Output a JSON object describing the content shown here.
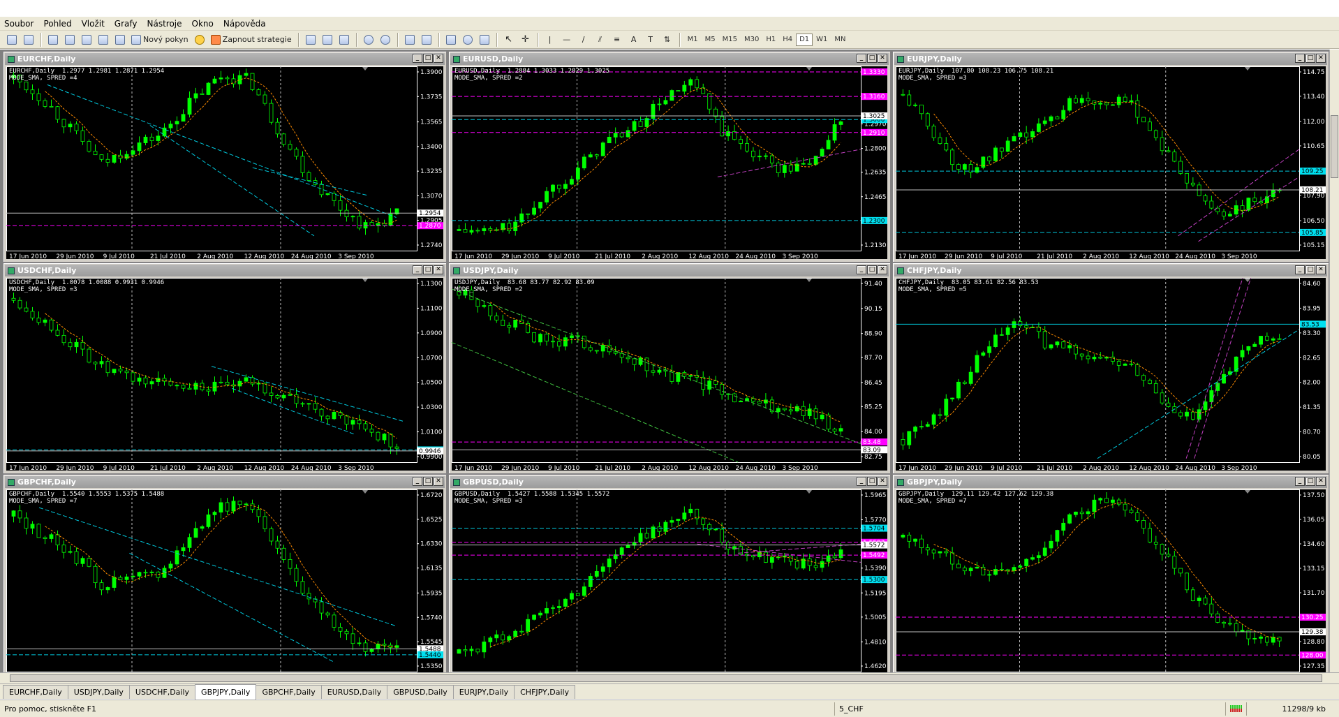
{
  "menu": [
    "Soubor",
    "Pohled",
    "Vložit",
    "Grafy",
    "Nástroje",
    "Okno",
    "Nápověda"
  ],
  "toolbar": {
    "new_order": "Nový pokyn",
    "strategies": "Zapnout strategie",
    "timeframes": [
      "M1",
      "M5",
      "M15",
      "M30",
      "H1",
      "H4",
      "D1",
      "W1",
      "MN"
    ],
    "active_timeframe": "D1"
  },
  "charts": [
    {
      "title": "EURCHF,Daily",
      "info1": "EURCHF,Daily  1.2977 1.2981 1.2871 1.2954",
      "info2": "MODE_SMA, SPRED =4",
      "prices": [
        "1.3900",
        "1.3735",
        "1.3565",
        "1.3400",
        "1.3235",
        "1.3070",
        "1.2905",
        "1.2740"
      ],
      "dates": [
        "17 Jun 2010",
        "29 Jun 2010",
        "9 Jul 2010",
        "21 Jul 2010",
        "2 Aug 2010",
        "12 Aug 2010",
        "24 Aug 2010",
        "3 Sep 2010"
      ],
      "trend": [
        1.386,
        1.372,
        1.35,
        1.328,
        1.34,
        1.348,
        1.37,
        1.387,
        1.385,
        1.35,
        1.32,
        1.3,
        1.285,
        1.295
      ],
      "hlines": [
        {
          "v": 1.2954,
          "c": "#c0c0c0",
          "dash": false,
          "tag": "1.2954",
          "tagc": "#fff",
          "tagt": "#000"
        },
        {
          "v": 1.287,
          "c": "#ff00ff",
          "dash": true,
          "tag": "1.2870",
          "tagc": "#ff00ff",
          "tagt": "#fff"
        }
      ],
      "tlines": [
        [
          0.1,
          0.1,
          0.95,
          0.82,
          "#00c8dc"
        ],
        [
          0.35,
          0.32,
          0.75,
          0.92,
          "#00c8dc"
        ],
        [
          0.6,
          0.55,
          0.88,
          0.7,
          "#00c8dc"
        ]
      ]
    },
    {
      "title": "EURUSD,Daily",
      "info1": "EURUSD,Daily  1.2884 1.3033 1.2829 1.3025",
      "info2": "MODE_SMA, SPRED =2",
      "prices": [
        "1.3330",
        "1.3160",
        "1.2970",
        "1.2800",
        "1.2635",
        "1.2465",
        "1.2300",
        "1.2130"
      ],
      "dates": [
        "17 Jun 2010",
        "29 Jun 2010",
        "9 Jul 2010",
        "21 Jul 2010",
        "2 Aug 2010",
        "12 Aug 2010",
        "24 Aug 2010",
        "3 Sep 2010"
      ],
      "trend": [
        1.223,
        1.222,
        1.228,
        1.25,
        1.265,
        1.285,
        1.295,
        1.315,
        1.325,
        1.29,
        1.278,
        1.265,
        1.27,
        1.3
      ],
      "hlines": [
        {
          "v": 1.333,
          "c": "#ff00ff",
          "dash": true,
          "tag": "1.3330",
          "tagc": "#ff00ff",
          "tagt": "#fff"
        },
        {
          "v": 1.316,
          "c": "#ff00ff",
          "dash": true,
          "tag": "1.3160",
          "tagc": "#ff00ff",
          "tagt": "#fff"
        },
        {
          "v": 1.3,
          "c": "#00c8dc",
          "dash": true,
          "tag": "1.3000",
          "tagc": "#00e0f0",
          "tagt": "#000"
        },
        {
          "v": 1.3025,
          "c": "#c0c0c0",
          "dash": false,
          "tag": "1.3025",
          "tagc": "#fff",
          "tagt": "#000"
        },
        {
          "v": 1.291,
          "c": "#ff00ff",
          "dash": true,
          "tag": "1.2910",
          "tagc": "#ff00ff",
          "tagt": "#fff"
        },
        {
          "v": 1.23,
          "c": "#00c8dc",
          "dash": true,
          "tag": "1.2300",
          "tagc": "#00e0f0",
          "tagt": "#000"
        }
      ],
      "tlines": [
        [
          0.65,
          0.6,
          1.0,
          0.45,
          "#c040c0"
        ]
      ]
    },
    {
      "title": "EURJPY,Daily",
      "info1": "EURJPY,Daily  107.80 108.23 106.75 108.21",
      "info2": "MODE_SMA, SPRED =3",
      "prices": [
        "114.75",
        "113.40",
        "112.00",
        "110.65",
        "109.25",
        "107.90",
        "106.50",
        "105.15"
      ],
      "dates": [
        "17 Jun 2010",
        "29 Jun 2010",
        "9 Jul 2010",
        "21 Jul 2010",
        "2 Aug 2010",
        "12 Aug 2010",
        "24 Aug 2010",
        "3 Sep 2010"
      ],
      "trend": [
        113.5,
        111.5,
        109.2,
        110,
        111,
        112,
        113.4,
        113.2,
        112.8,
        110.5,
        108.2,
        106.8,
        107.5,
        108
      ],
      "hlines": [
        {
          "v": 109.25,
          "c": "#00c8dc",
          "dash": true,
          "tag": "109.25",
          "tagc": "#00e0f0",
          "tagt": "#000"
        },
        {
          "v": 108.21,
          "c": "#c0c0c0",
          "dash": false,
          "tag": "108.21",
          "tagc": "#fff",
          "tagt": "#000"
        },
        {
          "v": 105.85,
          "c": "#00c8dc",
          "dash": true,
          "tag": "105.85",
          "tagc": "#00e0f0",
          "tagt": "#000"
        }
      ],
      "tlines": [
        [
          0.7,
          0.92,
          1.0,
          0.45,
          "#c040c0"
        ],
        [
          0.75,
          0.95,
          1.0,
          0.6,
          "#c040c0"
        ]
      ]
    },
    {
      "title": "USDCHF,Daily",
      "info1": "USDCHF,Daily  1.0078 1.0088 0.9931 0.9946",
      "info2": "MODE_SMA, SPRED =3",
      "prices": [
        "1.1300",
        "1.1100",
        "1.0900",
        "1.0700",
        "1.0500",
        "1.0300",
        "1.0100",
        "0.9900"
      ],
      "dates": [
        "17 Jun 2010",
        "29 Jun 2010",
        "9 Jul 2010",
        "21 Jul 2010",
        "2 Aug 2010",
        "12 Aug 2010",
        "24 Aug 2010",
        "3 Sep 2010"
      ],
      "trend": [
        1.118,
        1.1,
        1.08,
        1.062,
        1.052,
        1.05,
        1.048,
        1.045,
        1.05,
        1.04,
        1.03,
        1.02,
        1.012,
        1.0
      ],
      "hlines": [
        {
          "v": 0.9954,
          "c": "#00c8dc",
          "dash": true,
          "tag": "0.9954",
          "tagc": "#00e0f0",
          "tagt": "#000"
        },
        {
          "v": 0.9946,
          "c": "#c0c0c0",
          "dash": false,
          "tag": "0.9946",
          "tagc": "#fff",
          "tagt": "#000"
        }
      ],
      "tlines": [
        [
          0.5,
          0.48,
          0.97,
          0.78,
          "#00c8dc"
        ],
        [
          0.55,
          0.6,
          0.85,
          0.85,
          "#00c8dc"
        ]
      ]
    },
    {
      "title": "USDJPY,Daily",
      "info1": "USDJPY,Daily  83.68 83.77 82.92 83.09",
      "info2": "MODE_SMA, SPRED =2",
      "prices": [
        "91.40",
        "90.15",
        "88.90",
        "87.70",
        "86.45",
        "85.25",
        "84.00",
        "82.75"
      ],
      "dates": [
        "17 Jun 2010",
        "29 Jun 2010",
        "9 Jul 2010",
        "21 Jul 2010",
        "2 Aug 2010",
        "12 Aug 2010",
        "24 Aug 2010",
        "3 Sep 2010"
      ],
      "trend": [
        91,
        90,
        89.2,
        88.4,
        88.6,
        88,
        87.5,
        86.8,
        86.5,
        86,
        85.4,
        85.2,
        84.8,
        84.1
      ],
      "hlines": [
        {
          "v": 83.48,
          "c": "#ff00ff",
          "dash": true,
          "tag": "83.48",
          "tagc": "#ff00ff",
          "tagt": "#fff"
        },
        {
          "v": 83.09,
          "c": "#c0c0c0",
          "dash": false,
          "tag": "83.09",
          "tagc": "#fff",
          "tagt": "#000"
        }
      ],
      "tlines": [
        [
          0.0,
          0.06,
          1.0,
          0.9,
          "#40c040"
        ],
        [
          0.0,
          0.35,
          0.7,
          1.0,
          "#40c040"
        ]
      ]
    },
    {
      "title": "CHFJPY,Daily",
      "info1": "CHFJPY,Daily  83.05 83.61 82.56 83.53",
      "info2": "MODE_SMA, SPRED =5",
      "prices": [
        "84.60",
        "83.95",
        "83.30",
        "82.65",
        "82.00",
        "81.35",
        "80.70",
        "80.05"
      ],
      "dates": [
        "17 Jun 2010",
        "29 Jun 2010",
        "9 Jul 2010",
        "21 Jul 2010",
        "2 Aug 2010",
        "12 Aug 2010",
        "24 Aug 2010",
        "3 Sep 2010"
      ],
      "trend": [
        80.5,
        81,
        82,
        83,
        83.6,
        83,
        82.8,
        82.6,
        82.3,
        81.5,
        81,
        82,
        83,
        83.3
      ],
      "hlines": [
        {
          "v": 83.53,
          "c": "#00c8dc",
          "dash": false,
          "tag": "83.53",
          "tagc": "#00e0f0",
          "tagt": "#000"
        }
      ],
      "tlines": [
        [
          0.5,
          0.98,
          1.0,
          0.28,
          "#00c8dc"
        ],
        [
          0.72,
          0.98,
          0.86,
          0.0,
          "#c040c0"
        ],
        [
          0.74,
          0.98,
          0.88,
          0.0,
          "#c040c0"
        ]
      ]
    },
    {
      "title": "GBPCHF,Daily",
      "info1": "GBPCHF,Daily  1.5540 1.5553 1.5375 1.5488",
      "info2": "MODE_SMA, SPRED =7",
      "prices": [
        "1.6720",
        "1.6525",
        "1.6330",
        "1.6135",
        "1.5935",
        "1.5740",
        "1.5545",
        "1.5350"
      ],
      "dates": [
        "17 Jun 2010",
        "29 Jun 2010",
        "9 Jul 2010",
        "21 Jul 2010",
        "2 Aug 2010",
        "12 Aug 2010",
        "24 Aug 2010",
        "3 Sep 2010"
      ],
      "trend": [
        1.655,
        1.64,
        1.625,
        1.6,
        1.605,
        1.61,
        1.64,
        1.665,
        1.66,
        1.63,
        1.59,
        1.565,
        1.55,
        1.552
      ],
      "hlines": [
        {
          "v": 1.5488,
          "c": "#c0c0c0",
          "dash": false,
          "tag": "1.5488",
          "tagc": "#fff",
          "tagt": "#000"
        },
        {
          "v": 1.544,
          "c": "#00c8dc",
          "dash": true,
          "tag": "1.5440",
          "tagc": "#00e0f0",
          "tagt": "#000"
        }
      ],
      "tlines": [
        [
          0.08,
          0.1,
          0.95,
          0.75,
          "#00c8dc"
        ],
        [
          0.3,
          0.35,
          0.8,
          0.95,
          "#00c8dc"
        ]
      ]
    },
    {
      "title": "GBPUSD,Daily",
      "info1": "GBPUSD,Daily  1.5427 1.5588 1.5345 1.5572",
      "info2": "MODE_SMA, SPRED =3",
      "prices": [
        "1.5965",
        "1.5770",
        "1.5580",
        "1.5390",
        "1.5195",
        "1.5005",
        "1.4810",
        "1.4620"
      ],
      "dates": [],
      "trend": [
        1.472,
        1.48,
        1.492,
        1.505,
        1.52,
        1.545,
        1.56,
        1.575,
        1.582,
        1.56,
        1.55,
        1.545,
        1.54,
        1.55
      ],
      "hlines": [
        {
          "v": 1.5704,
          "c": "#00c8dc",
          "dash": true,
          "tag": "1.5704",
          "tagc": "#00e0f0",
          "tagt": "#000"
        },
        {
          "v": 1.5593,
          "c": "#ff00ff",
          "dash": true,
          "tag": "1.5593",
          "tagc": "#ff00ff",
          "tagt": "#fff"
        },
        {
          "v": 1.5572,
          "c": "#c0c0c0",
          "dash": false,
          "tag": "1.5572",
          "tagc": "#fff",
          "tagt": "#000"
        },
        {
          "v": 1.5492,
          "c": "#ff00ff",
          "dash": true,
          "tag": "1.5492",
          "tagc": "#ff00ff",
          "tagt": "#fff"
        },
        {
          "v": 1.53,
          "c": "#00c8dc",
          "dash": true,
          "tag": "1.5300",
          "tagc": "#00e0f0",
          "tagt": "#000"
        }
      ],
      "tlines": [
        [
          0.6,
          0.3,
          1.0,
          0.4,
          "#c040c0"
        ],
        [
          0.7,
          0.35,
          1.0,
          0.3,
          "#c040c0"
        ]
      ]
    },
    {
      "title": "GBPJPY,Daily",
      "info1": "GBPJPY,Daily  129.11 129.42 127.62 129.38",
      "info2": "MODE_SMA, SPRED =7",
      "prices": [
        "137.50",
        "136.05",
        "134.60",
        "133.15",
        "131.70",
        "130.25",
        "128.80",
        "127.35"
      ],
      "dates": [],
      "trend": [
        135,
        134.2,
        133.4,
        132.8,
        133.2,
        134.6,
        136.5,
        137.2,
        136,
        134,
        131.5,
        130,
        129.2,
        129
      ],
      "hlines": [
        {
          "v": 130.25,
          "c": "#ff00ff",
          "dash": true,
          "tag": "130.25",
          "tagc": "#ff00ff",
          "tagt": "#fff"
        },
        {
          "v": 129.38,
          "c": "#c0c0c0",
          "dash": false,
          "tag": "129.38",
          "tagc": "#fff",
          "tagt": "#000"
        },
        {
          "v": 128.0,
          "c": "#ff00ff",
          "dash": true,
          "tag": "128.00",
          "tagc": "#ff00ff",
          "tagt": "#fff"
        }
      ],
      "tlines": []
    }
  ],
  "tabs": [
    "EURCHF,Daily",
    "USDJPY,Daily",
    "USDCHF,Daily",
    "GBPJPY,Daily",
    "GBPCHF,Daily",
    "EURUSD,Daily",
    "GBPUSD,Daily",
    "EURJPY,Daily",
    "CHFJPY,Daily"
  ],
  "active_tab": "GBPJPY,Daily",
  "status": {
    "help": "Pro pomoc, stiskněte F1",
    "profile": "5_CHF",
    "traffic": "11298/9 kb"
  },
  "colors": {
    "bull": "#00ff00",
    "bear": "#000000",
    "wick": "#00ff00",
    "ma": "#ff8c00",
    "grid": "#c8c8c8",
    "axis": "#ffffff"
  }
}
